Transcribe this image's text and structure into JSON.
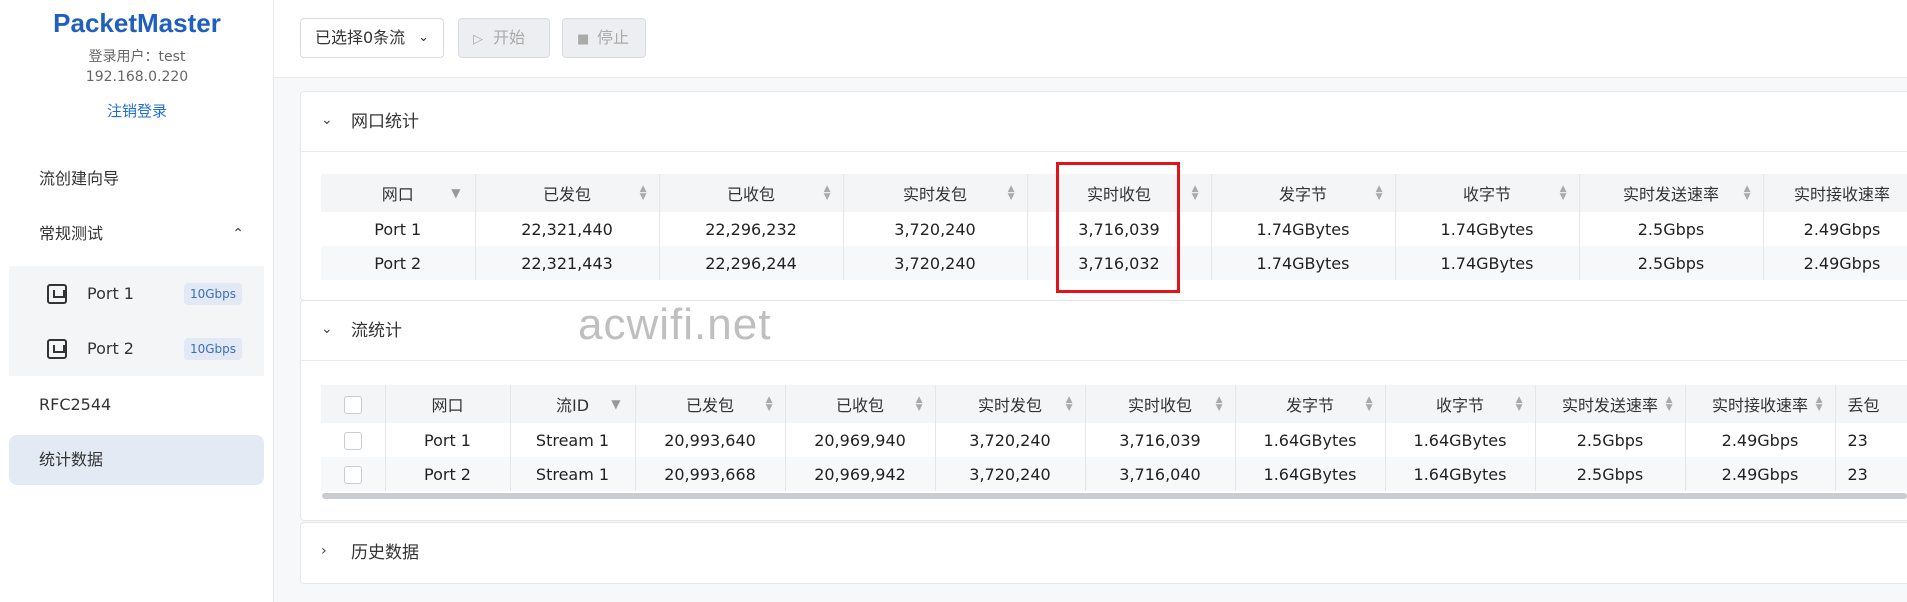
{
  "sidebar": {
    "brand": "PacketMaster",
    "user_line": "登录用户：test",
    "ip": "192.168.0.220",
    "logout": "注销登录",
    "nav": {
      "wizard": "流创建向导",
      "regular_test": "常规测试",
      "rfc": "RFC2544",
      "stats": "统计数据"
    },
    "ports": [
      {
        "label": "Port 1",
        "speed": "10Gbps"
      },
      {
        "label": "Port 2",
        "speed": "10Gbps"
      }
    ]
  },
  "toolbar": {
    "select_label": "已选择0条流",
    "start_label": "开始",
    "stop_label": "停止"
  },
  "port_stats": {
    "title": "网口统计",
    "headers": [
      "网口",
      "已发包",
      "已收包",
      "实时发包",
      "实时收包",
      "发字节",
      "收字节",
      "实时发送速率",
      "实时接收速率"
    ],
    "rows": [
      [
        "Port 1",
        "22,321,440",
        "22,296,232",
        "3,720,240",
        "3,716,039",
        "1.74GBytes",
        "1.74GBytes",
        "2.5Gbps",
        "2.49Gbps"
      ],
      [
        "Port 2",
        "22,321,443",
        "22,296,244",
        "3,720,240",
        "3,716,032",
        "1.74GBytes",
        "1.74GBytes",
        "2.5Gbps",
        "2.49Gbps"
      ]
    ]
  },
  "stream_stats": {
    "title": "流统计",
    "headers": [
      "网口",
      "流ID",
      "已发包",
      "已收包",
      "实时发包",
      "实时收包",
      "发字节",
      "收字节",
      "实时发送速率",
      "实时接收速率",
      "丢包"
    ],
    "rows": [
      [
        "Port 1",
        "Stream 1",
        "20,993,640",
        "20,969,940",
        "3,720,240",
        "3,716,039",
        "1.64GBytes",
        "1.64GBytes",
        "2.5Gbps",
        "2.49Gbps",
        "23"
      ],
      [
        "Port 2",
        "Stream 1",
        "20,993,668",
        "20,969,942",
        "3,720,240",
        "3,716,040",
        "1.64GBytes",
        "1.64GBytes",
        "2.5Gbps",
        "2.49Gbps",
        "23"
      ]
    ]
  },
  "history": {
    "title": "历史数据"
  },
  "watermark": "acwifi.net",
  "colors": {
    "brand": "#1f5fbf",
    "highlight": "#e0141a",
    "active_nav": "#e3eaf4"
  }
}
